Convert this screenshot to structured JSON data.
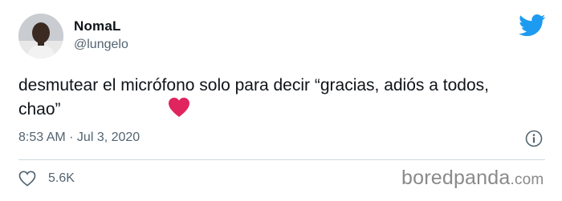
{
  "tweet": {
    "author_name": "NomaL",
    "author_handle": "@lungelo",
    "text": "desmutear el micrófono solo para decir “gracias, adiós a todos, chao”",
    "timestamp": "8:53 AM · Jul 3, 2020",
    "like_count": "5.6K",
    "emoji": "red-heart"
  },
  "icons": {
    "brand": "twitter-bird-icon",
    "info": "info-icon",
    "like": "heart-outline-icon"
  },
  "watermark": {
    "brand": "boredpanda",
    "suffix": ".com"
  },
  "colors": {
    "twitter_blue": "#1d9bf0",
    "heart_red": "#e0245e",
    "secondary_text": "#536471",
    "watermark": "#8a8a8a"
  }
}
